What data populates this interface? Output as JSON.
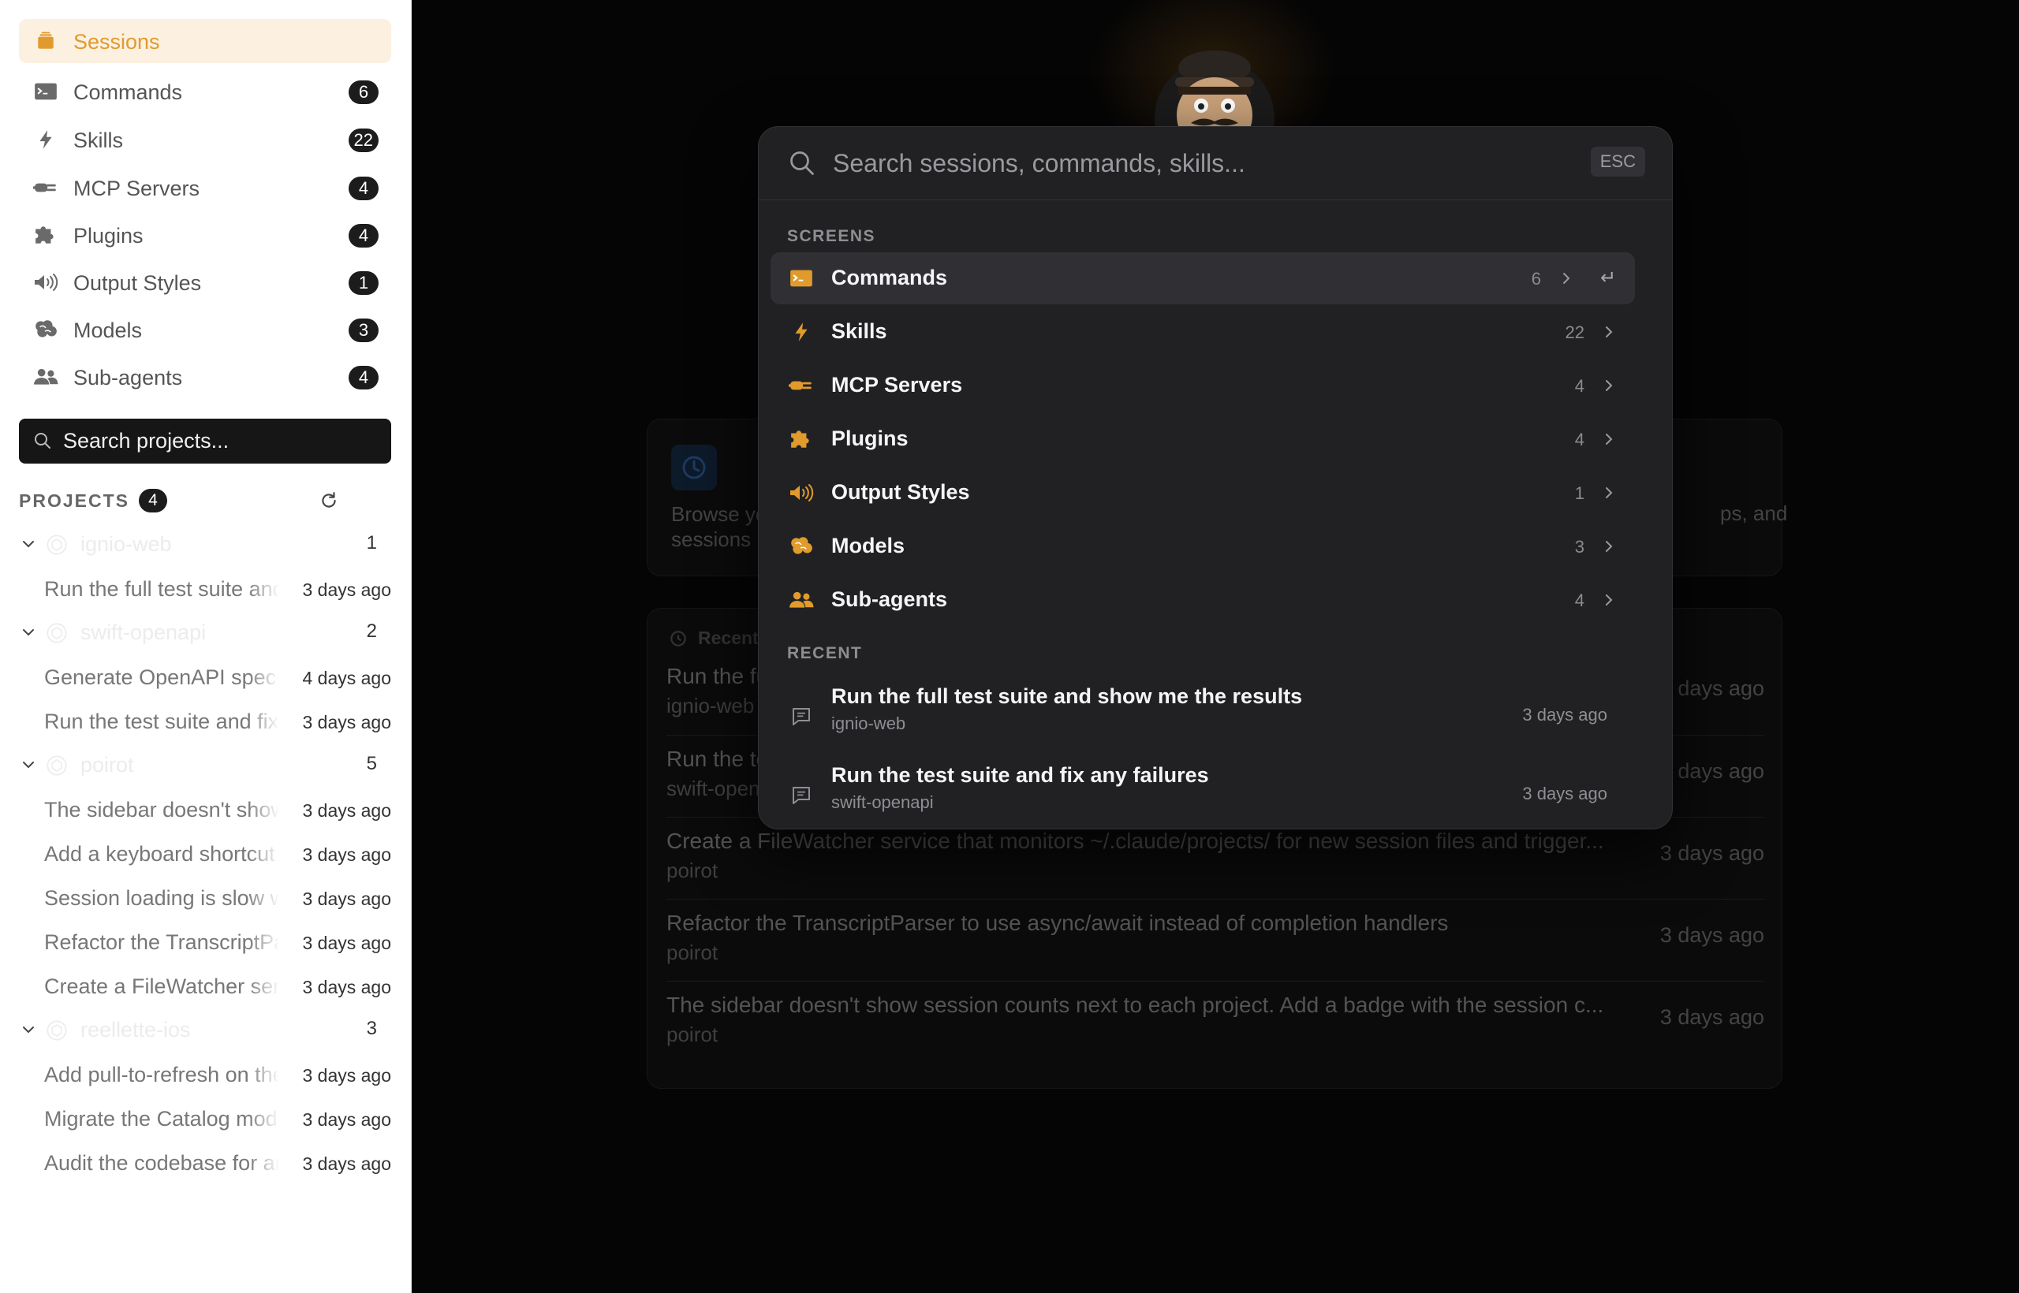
{
  "colors": {
    "accent": "#e19b2c",
    "sidebar_bg": "#ffffff",
    "palette_bg": "#212124"
  },
  "sidebar": {
    "nav": [
      {
        "label": "Sessions",
        "icon": "stack-icon",
        "count": null,
        "active": true
      },
      {
        "label": "Commands",
        "icon": "terminal-icon",
        "count": "6"
      },
      {
        "label": "Skills",
        "icon": "bolt-icon",
        "count": "22"
      },
      {
        "label": "MCP Servers",
        "icon": "plug-icon",
        "count": "4"
      },
      {
        "label": "Plugins",
        "icon": "puzzle-icon",
        "count": "4"
      },
      {
        "label": "Output Styles",
        "icon": "speaker-icon",
        "count": "1"
      },
      {
        "label": "Models",
        "icon": "brain-icon",
        "count": "3"
      },
      {
        "label": "Sub-agents",
        "icon": "people-icon",
        "count": "4"
      }
    ],
    "search_placeholder": "Search projects...",
    "projects_title": "PROJECTS",
    "projects_count": "4",
    "projects": [
      {
        "name": "ignio-web",
        "count": "1",
        "sessions": [
          {
            "title": "Run the full test suite and show me the results",
            "time": "3 days ago"
          }
        ]
      },
      {
        "name": "swift-openapi",
        "count": "2",
        "sessions": [
          {
            "title": "Generate OpenAPI spec",
            "time": "4 days ago"
          },
          {
            "title": "Run the test suite and fix any failures",
            "time": "3 days ago"
          }
        ]
      },
      {
        "name": "poirot",
        "count": "5",
        "sessions": [
          {
            "title": "The sidebar doesn't show session counts",
            "time": "3 days ago"
          },
          {
            "title": "Add a keyboard shortcut",
            "time": "3 days ago"
          },
          {
            "title": "Session loading is slow when",
            "time": "3 days ago"
          },
          {
            "title": "Refactor the TranscriptParser",
            "time": "3 days ago"
          },
          {
            "title": "Create a FileWatcher service",
            "time": "3 days ago"
          }
        ]
      },
      {
        "name": "reellette-ios",
        "count": "3",
        "sessions": [
          {
            "title": "Add pull-to-refresh on the",
            "time": "3 days ago"
          },
          {
            "title": "Migrate the Catalog model",
            "time": "3 days ago"
          },
          {
            "title": "Audit the codebase for any",
            "time": "3 days ago"
          }
        ]
      }
    ]
  },
  "background": {
    "browse_left": "Browse your sessions",
    "browse_right": "ps, and",
    "recent_heading": "Recent",
    "rows": [
      {
        "title": "Run the full test suite and show me the results",
        "project": "ignio-web",
        "time": "3 days ago"
      },
      {
        "title": "Run the test suite and fix any failures",
        "project": "swift-openapi",
        "time": "3 days ago"
      },
      {
        "title": "Create a FileWatcher service that monitors ~/.claude/projects/ for new session files and trigger...",
        "project": "poirot",
        "time": "3 days ago"
      },
      {
        "title": "Refactor the TranscriptParser to use async/await instead of completion handlers",
        "project": "poirot",
        "time": "3 days ago"
      },
      {
        "title": "The sidebar doesn't show session counts next to each project. Add a badge with the session c...",
        "project": "poirot",
        "time": "3 days ago"
      }
    ]
  },
  "palette": {
    "search_placeholder": "Search sessions, commands, skills...",
    "esc_label": "ESC",
    "screens_heading": "SCREENS",
    "recent_heading": "RECENT",
    "enter_glyph": "↵",
    "screens": [
      {
        "label": "Commands",
        "icon": "terminal-icon",
        "count": "6",
        "selected": true
      },
      {
        "label": "Skills",
        "icon": "bolt-icon",
        "count": "22"
      },
      {
        "label": "MCP Servers",
        "icon": "plug-icon",
        "count": "4"
      },
      {
        "label": "Plugins",
        "icon": "puzzle-icon",
        "count": "4"
      },
      {
        "label": "Output Styles",
        "icon": "speaker-icon",
        "count": "1"
      },
      {
        "label": "Models",
        "icon": "brain-icon",
        "count": "3"
      },
      {
        "label": "Sub-agents",
        "icon": "people-icon",
        "count": "4"
      }
    ],
    "recent": [
      {
        "title": "Run the full test suite and show me the results",
        "project": "ignio-web",
        "time": "3 days ago"
      },
      {
        "title": "Run the test suite and fix any failures",
        "project": "swift-openapi",
        "time": "3 days ago"
      }
    ]
  }
}
